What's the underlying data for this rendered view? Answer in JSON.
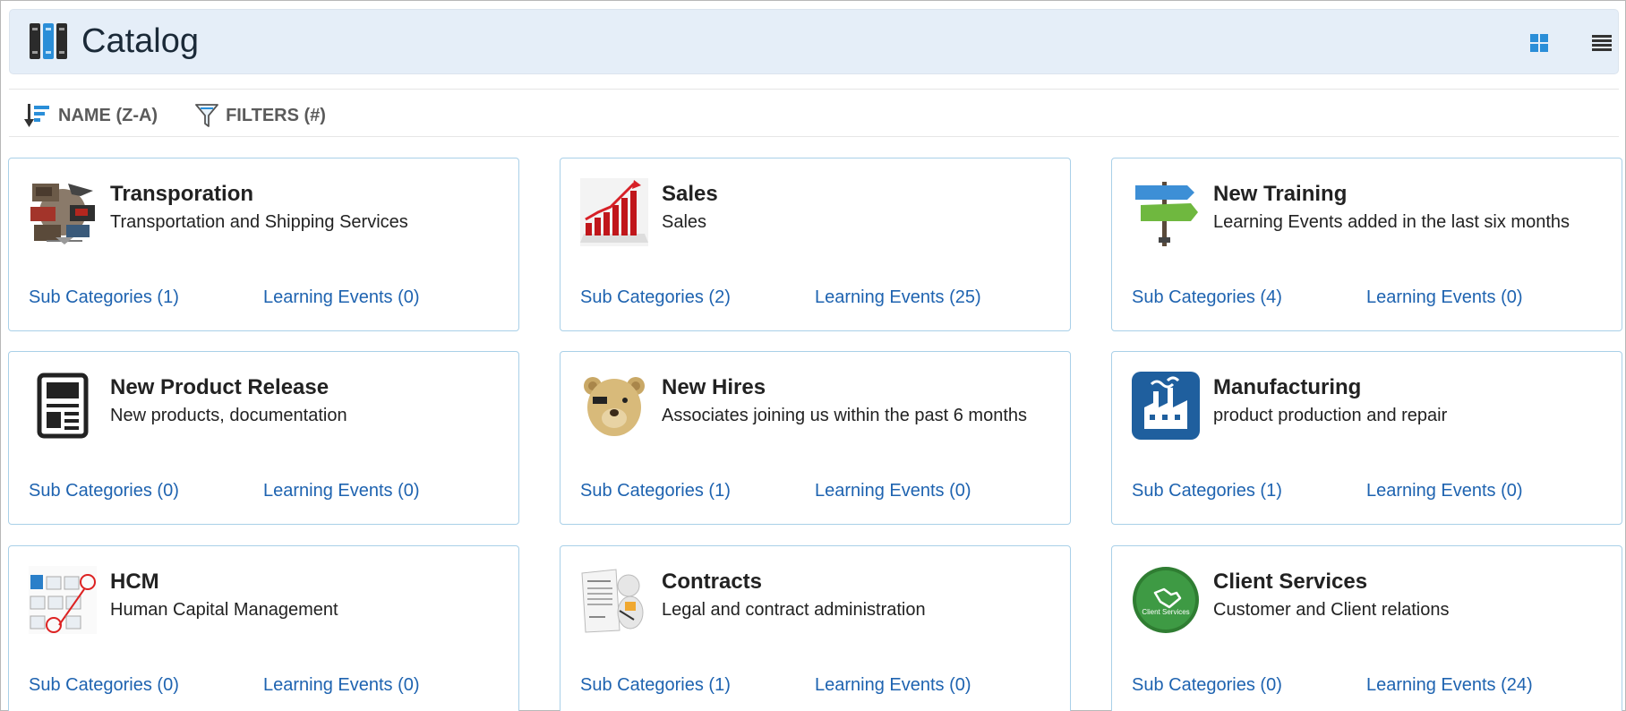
{
  "header": {
    "title": "Catalog",
    "logo_icon": "books-icon",
    "view_grid_icon": "grid-view-icon",
    "view_list_icon": "list-view-icon",
    "background_color": "#e5eef8"
  },
  "toolbar": {
    "sort_label": "NAME (Z-A)",
    "sort_icon": "sort-descending-icon",
    "filters_label": "FILTERS (#)",
    "filters_icon": "funnel-icon"
  },
  "colors": {
    "link": "#1e63b0",
    "card_border": "#a9d0e8",
    "accent_blue": "#2a8ed8"
  },
  "cards": [
    {
      "title": "Transporation",
      "description": "Transportation and Shipping Services",
      "sub_categories": "Sub Categories (1)",
      "learning_events": "Learning Events (0)",
      "icon": "transportation-collage-icon"
    },
    {
      "title": "Sales",
      "description": "Sales",
      "sub_categories": "Sub Categories (2)",
      "learning_events": "Learning Events (25)",
      "icon": "sales-growth-chart-icon"
    },
    {
      "title": "New Training",
      "description": "Learning Events added in the last six months",
      "sub_categories": "Sub Categories (4)",
      "learning_events": "Learning Events (0)",
      "icon": "training-signpost-icon"
    },
    {
      "title": "New Product Release",
      "description": "New products, documentation",
      "sub_categories": "Sub Categories (0)",
      "learning_events": "Learning Events (0)",
      "icon": "newspaper-icon"
    },
    {
      "title": "New Hires",
      "description": "Associates joining us within the past 6 months",
      "sub_categories": "Sub Categories (1)",
      "learning_events": "Learning Events (0)",
      "icon": "teddy-bear-icon"
    },
    {
      "title": "Manufacturing",
      "description": "product production and repair",
      "sub_categories": "Sub Categories (1)",
      "learning_events": "Learning Events (0)",
      "icon": "factory-icon"
    },
    {
      "title": "HCM",
      "description": "Human Capital Management",
      "sub_categories": "Sub Categories (0)",
      "learning_events": "Learning Events (0)",
      "icon": "hcm-org-chart-icon"
    },
    {
      "title": "Contracts",
      "description": "Legal and contract administration",
      "sub_categories": "Sub Categories (1)",
      "learning_events": "Learning Events (0)",
      "icon": "contract-signing-icon"
    },
    {
      "title": "Client Services",
      "description": "Customer and Client relations",
      "sub_categories": "Sub Categories (0)",
      "learning_events": "Learning Events (24)",
      "icon": "handshake-badge-icon",
      "badge_text": "Client Services"
    }
  ]
}
